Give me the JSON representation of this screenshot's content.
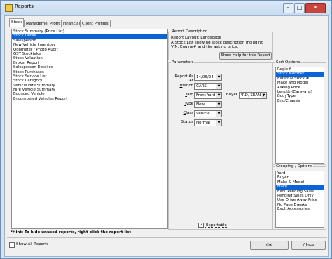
{
  "window": {
    "title": "Reports",
    "minimize": "–",
    "maximize": "□",
    "close": "✕"
  },
  "tabs": [
    "Stock",
    "Management",
    "Profit",
    "Financial",
    "Client Profiles"
  ],
  "reports": [
    "Stock Summary (Price List)",
    "Stock Detail",
    "Salesperson",
    "New Vehicle Inventory",
    "Odometer / Photo Audit",
    "GST Stocktake",
    "Stock Valuation",
    "Broker Report",
    "Salesperson Detailed",
    "Stock Purchases",
    "Stock Service List",
    "Stock Category",
    "Vehicle Hire Summary",
    "Hire Vehicle Summary",
    "Bounced Vehicle",
    "Encumbered Vehicles Report"
  ],
  "reports_selected": 1,
  "description": {
    "title": "Report Description",
    "text": "Report Layout: Landscape\nA Stock List showing stock description including VIN, Engine# and the asking price.",
    "help_button": "Show Help for this Report"
  },
  "parameters": {
    "title": "Parameters",
    "report_as_at_label": "Report As At",
    "report_as_at_value": "14/06/24",
    "branch_label": "Branch",
    "branch_value": "CARS",
    "yard_label": "Yard",
    "yard_value": "Front Yard",
    "buyer_label": "Buyer",
    "buyer_value": "\\RD, SEAN",
    "type_label": "Type",
    "type_value": "New",
    "class_label": "Class",
    "class_value": "Vehicle",
    "status_label": "Status",
    "status_value": "Normal",
    "exportable_label": "Exportable",
    "exportable_checked": "✓"
  },
  "sort_options": {
    "title": "Sort Options",
    "items": [
      "Regio#",
      "Stock Number",
      "External Stock #",
      "Make and Model",
      "Asking Price",
      "Length (Caravans)",
      "BodyType",
      "Eng/Chassis"
    ],
    "selected": 1
  },
  "grouping": {
    "title": "Grouping / Options",
    "items": [
      "Yard",
      "Buyer",
      "Make & Model",
      "Make",
      "Excl. Pending Sales",
      "Pending Sales Only",
      "Use Drive Away Price",
      "No Page Breaks",
      "Excl. Accessories"
    ],
    "selected": 3
  },
  "hint": "*Hint: To hide unused reports, right-click the report list",
  "show_all_label": "Show All Reports",
  "ok_label": "OK",
  "close_label": "Close"
}
